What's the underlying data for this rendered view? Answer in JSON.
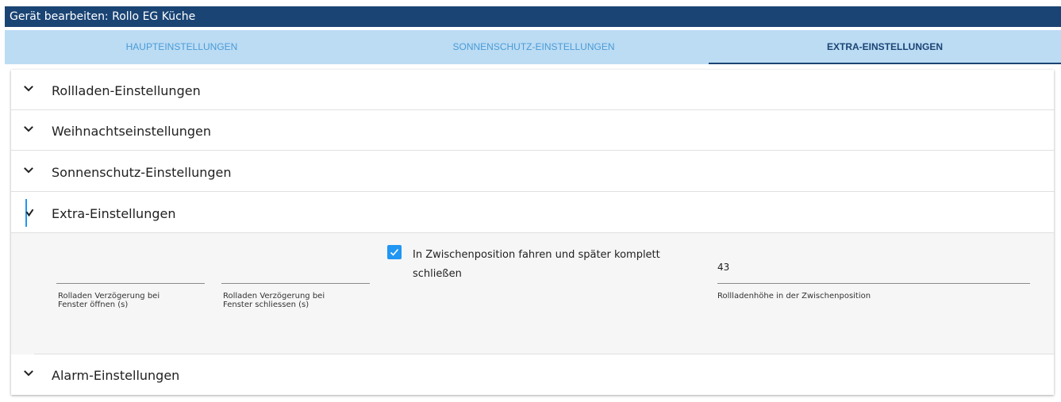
{
  "window": {
    "title": "Gerät bearbeiten: Rollo EG Küche"
  },
  "tabs": [
    {
      "label": "HAUPTEINSTELLUNGEN",
      "active": false
    },
    {
      "label": "SONNENSCHUTZ-EINSTELLUNGEN",
      "active": false
    },
    {
      "label": "EXTRA-EINSTELLUNGEN",
      "active": true
    }
  ],
  "sections": [
    {
      "label": "Rollladen-Einstellungen",
      "expanded": false,
      "icon": "chevron-down-icon"
    },
    {
      "label": "Weihnachtseinstellungen",
      "expanded": false,
      "icon": "chevron-down-icon"
    },
    {
      "label": "Sonnenschutz-Einstellungen",
      "expanded": false,
      "icon": "chevron-down-icon"
    },
    {
      "label": "Extra-Einstellungen",
      "expanded": true,
      "icon": "chevron-up-icon"
    },
    {
      "label": "Alarm-Einstellungen",
      "expanded": false,
      "icon": "chevron-down-icon"
    }
  ],
  "extra": {
    "delay_open": {
      "label": "Rolladen Verzögerung bei\nFenster öffnen (s)",
      "value": ""
    },
    "delay_close": {
      "label": "Rolladen Verzögerung bei\nFenster schliessen (s)",
      "value": ""
    },
    "intermediate": {
      "label": "In Zwischenposition fahren und später komplett\nschließen",
      "checked": true
    },
    "intermediate_height": {
      "label": "Rollladenhöhe in der Zwischenposition",
      "value": "43"
    }
  },
  "colors": {
    "title_bar": "#1a4474",
    "tab_bar": "#bcdcf4",
    "tab_text": "#4a9bd6",
    "accent": "#2196f3"
  }
}
